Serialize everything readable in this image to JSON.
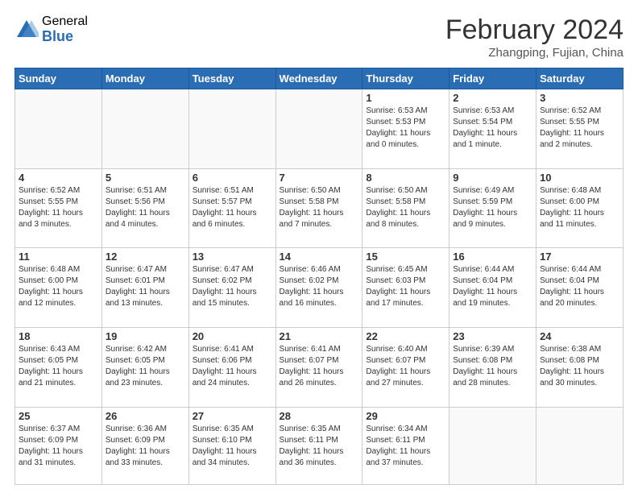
{
  "logo": {
    "general": "General",
    "blue": "Blue"
  },
  "header": {
    "month_year": "February 2024",
    "location": "Zhangping, Fujian, China"
  },
  "days_of_week": [
    "Sunday",
    "Monday",
    "Tuesday",
    "Wednesday",
    "Thursday",
    "Friday",
    "Saturday"
  ],
  "weeks": [
    [
      {
        "day": "",
        "info": ""
      },
      {
        "day": "",
        "info": ""
      },
      {
        "day": "",
        "info": ""
      },
      {
        "day": "",
        "info": ""
      },
      {
        "day": "1",
        "info": "Sunrise: 6:53 AM\nSunset: 5:53 PM\nDaylight: 11 hours and 0 minutes."
      },
      {
        "day": "2",
        "info": "Sunrise: 6:53 AM\nSunset: 5:54 PM\nDaylight: 11 hours and 1 minute."
      },
      {
        "day": "3",
        "info": "Sunrise: 6:52 AM\nSunset: 5:55 PM\nDaylight: 11 hours and 2 minutes."
      }
    ],
    [
      {
        "day": "4",
        "info": "Sunrise: 6:52 AM\nSunset: 5:55 PM\nDaylight: 11 hours and 3 minutes."
      },
      {
        "day": "5",
        "info": "Sunrise: 6:51 AM\nSunset: 5:56 PM\nDaylight: 11 hours and 4 minutes."
      },
      {
        "day": "6",
        "info": "Sunrise: 6:51 AM\nSunset: 5:57 PM\nDaylight: 11 hours and 6 minutes."
      },
      {
        "day": "7",
        "info": "Sunrise: 6:50 AM\nSunset: 5:58 PM\nDaylight: 11 hours and 7 minutes."
      },
      {
        "day": "8",
        "info": "Sunrise: 6:50 AM\nSunset: 5:58 PM\nDaylight: 11 hours and 8 minutes."
      },
      {
        "day": "9",
        "info": "Sunrise: 6:49 AM\nSunset: 5:59 PM\nDaylight: 11 hours and 9 minutes."
      },
      {
        "day": "10",
        "info": "Sunrise: 6:48 AM\nSunset: 6:00 PM\nDaylight: 11 hours and 11 minutes."
      }
    ],
    [
      {
        "day": "11",
        "info": "Sunrise: 6:48 AM\nSunset: 6:00 PM\nDaylight: 11 hours and 12 minutes."
      },
      {
        "day": "12",
        "info": "Sunrise: 6:47 AM\nSunset: 6:01 PM\nDaylight: 11 hours and 13 minutes."
      },
      {
        "day": "13",
        "info": "Sunrise: 6:47 AM\nSunset: 6:02 PM\nDaylight: 11 hours and 15 minutes."
      },
      {
        "day": "14",
        "info": "Sunrise: 6:46 AM\nSunset: 6:02 PM\nDaylight: 11 hours and 16 minutes."
      },
      {
        "day": "15",
        "info": "Sunrise: 6:45 AM\nSunset: 6:03 PM\nDaylight: 11 hours and 17 minutes."
      },
      {
        "day": "16",
        "info": "Sunrise: 6:44 AM\nSunset: 6:04 PM\nDaylight: 11 hours and 19 minutes."
      },
      {
        "day": "17",
        "info": "Sunrise: 6:44 AM\nSunset: 6:04 PM\nDaylight: 11 hours and 20 minutes."
      }
    ],
    [
      {
        "day": "18",
        "info": "Sunrise: 6:43 AM\nSunset: 6:05 PM\nDaylight: 11 hours and 21 minutes."
      },
      {
        "day": "19",
        "info": "Sunrise: 6:42 AM\nSunset: 6:05 PM\nDaylight: 11 hours and 23 minutes."
      },
      {
        "day": "20",
        "info": "Sunrise: 6:41 AM\nSunset: 6:06 PM\nDaylight: 11 hours and 24 minutes."
      },
      {
        "day": "21",
        "info": "Sunrise: 6:41 AM\nSunset: 6:07 PM\nDaylight: 11 hours and 26 minutes."
      },
      {
        "day": "22",
        "info": "Sunrise: 6:40 AM\nSunset: 6:07 PM\nDaylight: 11 hours and 27 minutes."
      },
      {
        "day": "23",
        "info": "Sunrise: 6:39 AM\nSunset: 6:08 PM\nDaylight: 11 hours and 28 minutes."
      },
      {
        "day": "24",
        "info": "Sunrise: 6:38 AM\nSunset: 6:08 PM\nDaylight: 11 hours and 30 minutes."
      }
    ],
    [
      {
        "day": "25",
        "info": "Sunrise: 6:37 AM\nSunset: 6:09 PM\nDaylight: 11 hours and 31 minutes."
      },
      {
        "day": "26",
        "info": "Sunrise: 6:36 AM\nSunset: 6:09 PM\nDaylight: 11 hours and 33 minutes."
      },
      {
        "day": "27",
        "info": "Sunrise: 6:35 AM\nSunset: 6:10 PM\nDaylight: 11 hours and 34 minutes."
      },
      {
        "day": "28",
        "info": "Sunrise: 6:35 AM\nSunset: 6:11 PM\nDaylight: 11 hours and 36 minutes."
      },
      {
        "day": "29",
        "info": "Sunrise: 6:34 AM\nSunset: 6:11 PM\nDaylight: 11 hours and 37 minutes."
      },
      {
        "day": "",
        "info": ""
      },
      {
        "day": "",
        "info": ""
      }
    ]
  ]
}
